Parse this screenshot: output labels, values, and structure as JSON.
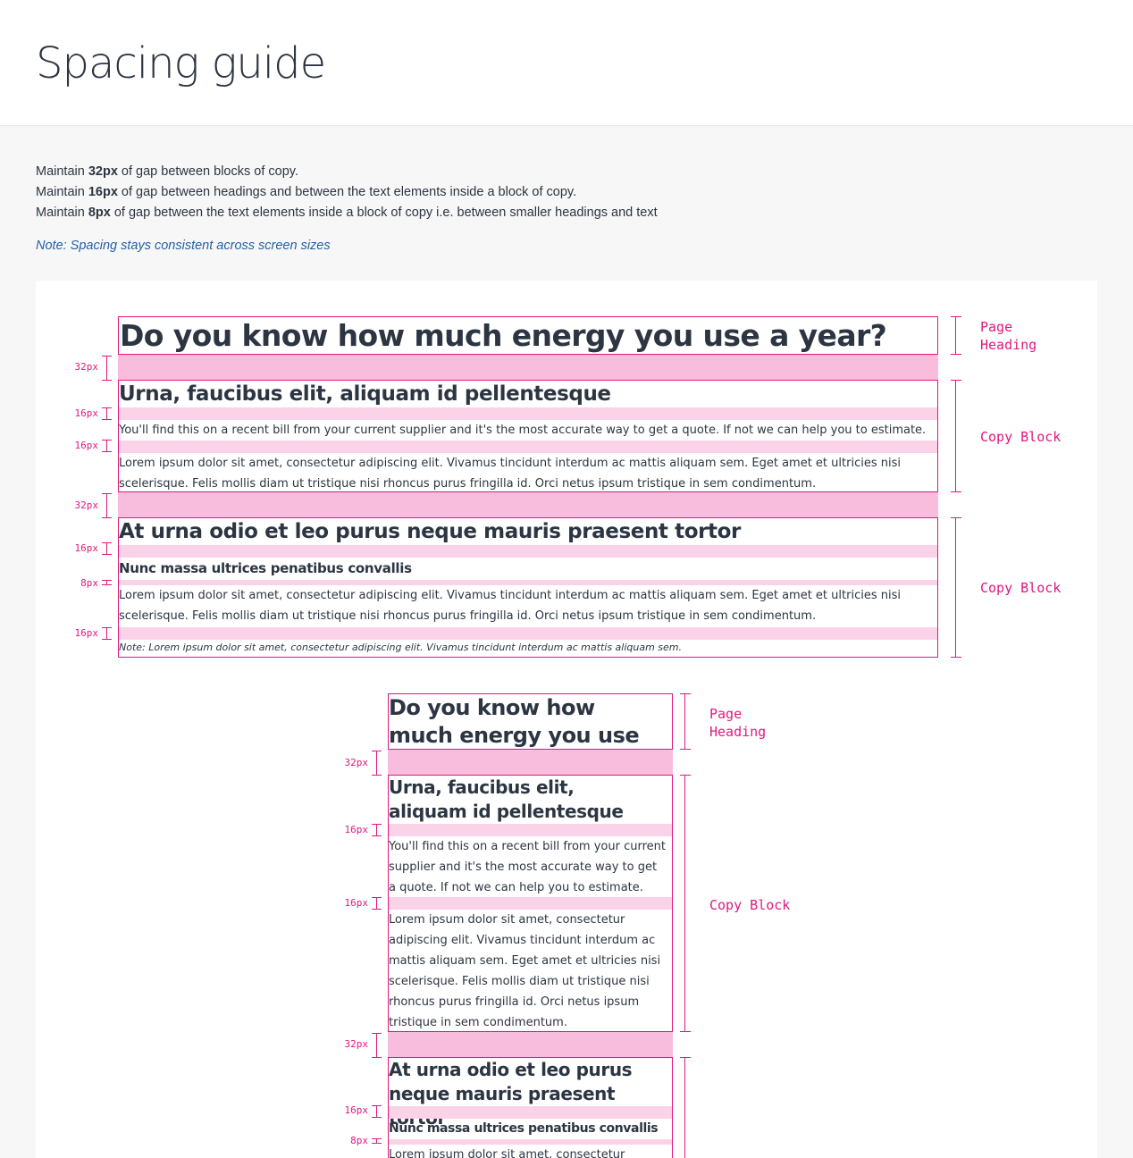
{
  "header": {
    "title": "Spacing guide"
  },
  "intro": {
    "lines": [
      {
        "pre": "Maintain ",
        "bold": "32px",
        "post": " of gap between blocks of copy."
      },
      {
        "pre": "Maintain ",
        "bold": "16px",
        "post": " of gap between headings and between the text elements inside a block of copy."
      },
      {
        "pre": "Maintain ",
        "bold": "8px",
        "post": " of gap between the text elements inside a block of copy i.e. between smaller headings and text"
      }
    ],
    "note": "Note: Spacing stays consistent across screen sizes"
  },
  "labels": {
    "px32": "32px",
    "px16": "16px",
    "px8": "8px",
    "page_heading": "Page\nHeading",
    "copy_block": "Copy Block"
  },
  "desktop": {
    "page_heading": "Do you know how much energy you use a year?",
    "block1": {
      "heading": "Urna, faucibus elit, aliquam id pellentesque",
      "body1": "You'll find this on a recent bill from your current supplier and it's the most accurate way to get a quote. If not we can help you to estimate.",
      "body2": "Lorem ipsum dolor sit amet, consectetur adipiscing elit. Vivamus tincidunt interdum ac mattis aliquam sem. Eget amet et ultricies nisi scelerisque. Felis mollis diam ut tristique nisi rhoncus purus fringilla id. Orci netus ipsum tristique in sem condimentum."
    },
    "block2": {
      "heading": "At urna odio et leo purus neque mauris praesent tortor",
      "subheading": "Nunc massa ultrices penatibus convallis",
      "body": "Lorem ipsum dolor sit amet, consectetur adipiscing elit. Vivamus tincidunt interdum ac mattis aliquam sem. Eget amet et ultricies nisi scelerisque. Felis mollis diam ut tristique nisi rhoncus purus fringilla id. Orci netus ipsum tristique in sem condimentum.",
      "note": "Note: Lorem ipsum dolor sit amet, consectetur adipiscing elit. Vivamus tincidunt interdum ac mattis aliquam sem."
    }
  },
  "mobile": {
    "page_heading": "Do you know how much energy you use a year?",
    "block1": {
      "heading": "Urna, faucibus elit, aliquam id pellentesque",
      "body1": "You'll find this on a recent bill from your current supplier and it's the most accurate way to get a quote. If not we can help you to estimate.",
      "body2": "Lorem ipsum dolor sit amet, consectetur adipiscing elit. Vivamus tincidunt interdum ac mattis aliquam sem. Eget amet et ultricies nisi scelerisque. Felis mollis diam ut tristique nisi rhoncus purus fringilla id. Orci netus ipsum tristique in sem condimentum."
    },
    "block2": {
      "heading": "At urna odio et leo purus neque mauris praesent tortor",
      "subheading": "Nunc massa ultrices penatibus convallis",
      "body": "Lorem ipsum dolor sit amet, consectetur"
    }
  },
  "colors": {
    "accent": "#e2177e",
    "gap": "#f8bddd",
    "text": "#2c3542",
    "note": "#2260a8"
  }
}
